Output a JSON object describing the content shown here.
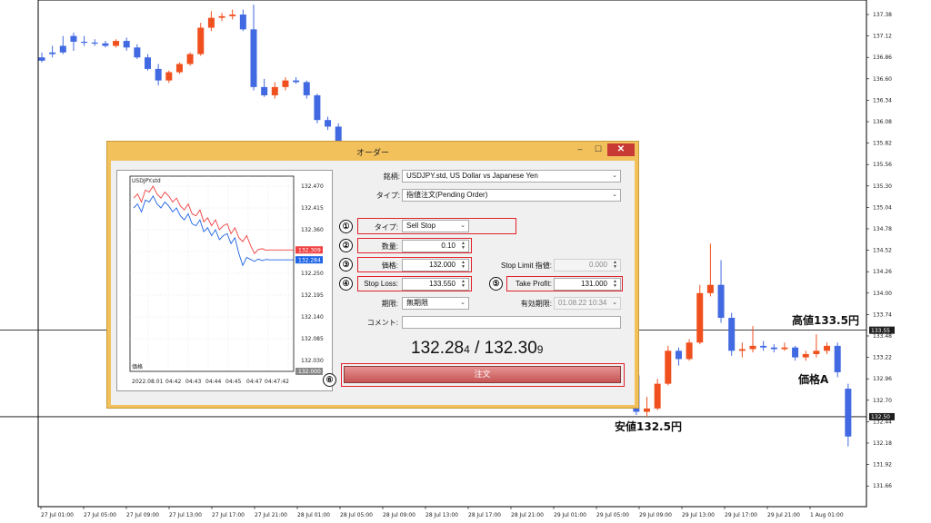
{
  "chart": {
    "price_axis": [
      "137.38",
      "137.12",
      "136.86",
      "136.60",
      "136.34",
      "136.08",
      "135.82",
      "135.56",
      "135.30",
      "135.04",
      "134.78",
      "134.52",
      "134.26",
      "134.00",
      "133.74",
      "133.48",
      "133.22",
      "132.96",
      "132.70",
      "132.44",
      "132.18",
      "131.92",
      "131.66"
    ],
    "time_axis": [
      "27 Jul 01:00",
      "27 Jul 05:00",
      "27 Jul 09:00",
      "27 Jul 13:00",
      "27 Jul 17:00",
      "27 Jul 21:00",
      "28 Jul 01:00",
      "28 Jul 05:00",
      "28 Jul 09:00",
      "28 Jul 13:00",
      "28 Jul 17:00",
      "28 Jul 21:00",
      "29 Jul 01:00",
      "29 Jul 05:00",
      "29 Jul 09:00",
      "29 Jul 13:00",
      "29 Jul 17:00",
      "29 Jul 21:00",
      "1 Aug 01:00"
    ],
    "high_line_price": "133.55",
    "low_line_price": "132.50",
    "annotation_high": "高値133.5円",
    "annotation_low": "安値132.5円",
    "annotation_price": "価格A",
    "colors": {
      "bull": "#f0501e",
      "bear": "#4169e1",
      "price_tag": "#1f1f1f"
    },
    "candles": [
      [
        136.86,
        136.92,
        136.82,
        136.8
      ],
      [
        136.92,
        137.0,
        136.9,
        136.86
      ],
      [
        137.0,
        137.12,
        136.92,
        136.9
      ],
      [
        137.12,
        137.16,
        137.05,
        136.94
      ],
      [
        137.05,
        137.12,
        137.04,
        137.0
      ],
      [
        137.04,
        137.08,
        137.03,
        137.0
      ],
      [
        137.03,
        137.06,
        137.0,
        136.98
      ],
      [
        137.0,
        137.08,
        137.06,
        136.98
      ],
      [
        137.06,
        137.1,
        136.98,
        136.94
      ],
      [
        136.98,
        137.02,
        136.86,
        136.84
      ],
      [
        136.86,
        136.9,
        136.72,
        136.7
      ],
      [
        136.72,
        136.78,
        136.58,
        136.52
      ],
      [
        136.58,
        136.7,
        136.68,
        136.55
      ],
      [
        136.68,
        136.8,
        136.78,
        136.66
      ],
      [
        136.78,
        136.92,
        136.9,
        136.76
      ],
      [
        136.9,
        137.28,
        137.22,
        136.88
      ],
      [
        137.22,
        137.42,
        137.34,
        137.18
      ],
      [
        137.34,
        137.4,
        137.36,
        137.3
      ],
      [
        137.36,
        137.44,
        137.38,
        137.32
      ],
      [
        137.38,
        137.44,
        137.2,
        137.18
      ],
      [
        137.2,
        137.5,
        136.5,
        136.46
      ],
      [
        136.5,
        136.6,
        136.4,
        136.38
      ],
      [
        136.4,
        136.56,
        136.5,
        136.36
      ],
      [
        136.5,
        136.62,
        136.58,
        136.46
      ],
      [
        136.58,
        136.62,
        136.56,
        136.54
      ],
      [
        136.56,
        136.58,
        136.4,
        136.36
      ],
      [
        136.4,
        136.42,
        136.1,
        136.06
      ],
      [
        136.1,
        136.14,
        136.02,
        135.98
      ],
      [
        136.02,
        136.06,
        135.7,
        135.66
      ],
      [
        133.0,
        133.12,
        132.56,
        132.52
      ],
      [
        132.56,
        132.74,
        132.6,
        132.5
      ],
      [
        132.6,
        132.96,
        132.9,
        132.58
      ],
      [
        132.9,
        133.36,
        133.3,
        132.88
      ],
      [
        133.3,
        133.34,
        133.2,
        133.12
      ],
      [
        133.2,
        133.44,
        133.4,
        133.18
      ],
      [
        133.4,
        134.1,
        134.0,
        133.38
      ],
      [
        134.0,
        134.6,
        134.1,
        133.96
      ],
      [
        134.1,
        134.4,
        133.7,
        133.64
      ],
      [
        133.7,
        133.76,
        133.3,
        133.24
      ],
      [
        133.3,
        133.4,
        133.32,
        133.22
      ],
      [
        133.32,
        133.6,
        133.36,
        133.28
      ],
      [
        133.36,
        133.42,
        133.34,
        133.3
      ],
      [
        133.34,
        133.38,
        133.32,
        133.28
      ],
      [
        133.32,
        133.4,
        133.34,
        133.3
      ],
      [
        133.34,
        133.36,
        133.22,
        133.18
      ],
      [
        133.22,
        133.3,
        133.26,
        133.18
      ],
      [
        133.26,
        133.5,
        133.3,
        133.22
      ],
      [
        133.3,
        133.4,
        133.36,
        133.26
      ],
      [
        133.36,
        133.4,
        133.04,
        132.98
      ],
      [
        132.84,
        132.9,
        132.26,
        132.14
      ]
    ]
  },
  "dialog": {
    "title": "オーダー",
    "window_buttons": {
      "minimize": "–",
      "maximize": "☐",
      "close": "✕"
    },
    "mini_chart": {
      "symbol": "USDJPY.std",
      "price_labels": [
        "132.470",
        "132.415",
        "132.360",
        "132.250",
        "132.195",
        "132.140",
        "132.085",
        "132.030"
      ],
      "ask_tag": "132.309",
      "bid_tag": "132.284",
      "bottom_tag": "132.000",
      "time_labels": [
        "2022.08.01",
        "04:42",
        "04:43",
        "04:44",
        "04:45",
        "04:47",
        "04:47:42"
      ],
      "legend": "価格",
      "colors": {
        "ask": "#f04040",
        "bid": "#1e64e6"
      },
      "ask_series": [
        132.44,
        132.45,
        132.43,
        132.46,
        132.455,
        132.47,
        132.45,
        132.44,
        132.455,
        132.445,
        132.43,
        132.44,
        132.42,
        132.41,
        132.425,
        132.4,
        132.395,
        132.41,
        132.38,
        132.39,
        132.37,
        132.385,
        132.36,
        132.37,
        132.375,
        132.35,
        132.365,
        132.34,
        132.33,
        132.345,
        132.32,
        132.3,
        132.31,
        132.312,
        132.308,
        132.309
      ],
      "bid_series": [
        132.415,
        132.425,
        132.405,
        132.435,
        132.43,
        132.445,
        132.425,
        132.415,
        132.43,
        132.42,
        132.405,
        132.415,
        132.395,
        132.385,
        132.4,
        132.375,
        132.37,
        132.385,
        132.355,
        132.365,
        132.345,
        132.36,
        132.335,
        132.345,
        132.35,
        132.325,
        132.34,
        132.3,
        132.27,
        132.29,
        132.285,
        132.28,
        132.286,
        132.282,
        132.285,
        132.284
      ]
    },
    "symbol_label": "銘柄:",
    "symbol_value": "USDJPY.std, US Dollar vs Japanese Yen",
    "type_label": "タイプ:",
    "type_value": "指値注文(Pending Order)",
    "order_type_label": "タイプ:",
    "order_type_value": "Sell Stop",
    "volume_label": "数量:",
    "volume_value": "0.10",
    "price_label": "価格:",
    "price_value": "132.000",
    "stop_limit_label": "Stop Limit 指値:",
    "stop_limit_value": "0.000",
    "stop_loss_label": "Stop Loss:",
    "stop_loss_value": "133.550",
    "take_profit_label": "Take Profit:",
    "take_profit_value": "131.000",
    "expiry_label": "期限:",
    "expiry_value": "無期限",
    "expiry_date_label": "有効期限:",
    "expiry_date_value": "01.08.22 10:34",
    "comment_label": "コメント:",
    "comment_value": "",
    "bid_main": "132.28",
    "bid_sub": "4",
    "separator": " / ",
    "ask_main": "132.30",
    "ask_sub": "9",
    "order_button": "注文",
    "badges": [
      "①",
      "②",
      "③",
      "④",
      "⑤",
      "⑥"
    ]
  }
}
